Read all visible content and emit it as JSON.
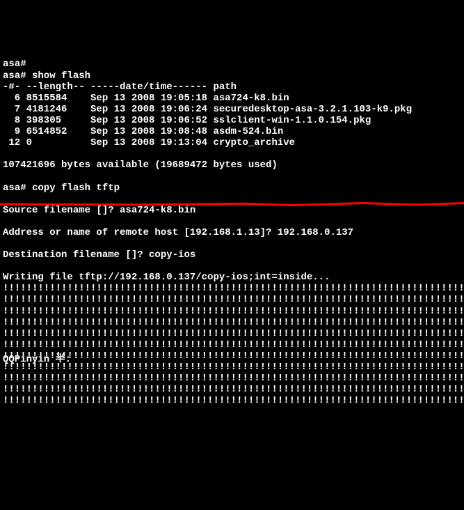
{
  "prompt1": "asa#",
  "prompt2": "asa# show flash",
  "header": "-#- --length-- -----date/time------ path",
  "files": [
    "  6 8515584    Sep 13 2008 19:05:18 asa724-k8.bin",
    "  7 4181246    Sep 13 2008 19:06:24 securedesktop-asa-3.2.1.103-k9.pkg",
    "  8 398305     Sep 13 2008 19:06:52 sslclient-win-1.1.0.154.pkg",
    "  9 6514852    Sep 13 2008 19:08:48 asdm-524.bin",
    " 12 0          Sep 13 2008 19:13:04 crypto_archive"
  ],
  "bytes": "107421696 bytes available (19689472 bytes used)",
  "copy_cmd": "asa# copy flash tftp",
  "src_prompt": "Source filename []? asa724-k8.bin",
  "host_prompt": "Address or name of remote host [192.168.1.13]? 192.168.0.137",
  "dest_prompt": "Destination filename []? copy-ios",
  "writing": "Writing file tftp://192.168.0.137/copy-ios;int=inside...",
  "progress_rows": [
    "!!!!!!!!!!!!!!!!!!!!!!!!!!!!!!!!!!!!!!!!!!!!!!!!!!!!!!!!!!!!!!!!!!!!!!!!!!!!!!!!",
    "!!!!!!!!!!!!!!!!!!!!!!!!!!!!!!!!!!!!!!!!!!!!!!!!!!!!!!!!!!!!!!!!!!!!!!!!!!!!!!!!",
    "!!!!!!!!!!!!!!!!!!!!!!!!!!!!!!!!!!!!!!!!!!!!!!!!!!!!!!!!!!!!!!!!!!!!!!!!!!!!!!!!",
    "!!!!!!!!!!!!!!!!!!!!!!!!!!!!!!!!!!!!!!!!!!!!!!!!!!!!!!!!!!!!!!!!!!!!!!!!!!!!!!!!",
    "!!!!!!!!!!!!!!!!!!!!!!!!!!!!!!!!!!!!!!!!!!!!!!!!!!!!!!!!!!!!!!!!!!!!!!!!!!!!!!!!",
    "!!!!!!!!!!!!!!!!!!!!!!!!!!!!!!!!!!!!!!!!!!!!!!!!!!!!!!!!!!!!!!!!!!!!!!!!!!!!!!!!",
    "!!!!!!!!!!!!!!!!!!!!!!!!!!!!!!!!!!!!!!!!!!!!!!!!!!!!!!!!!!!!!!!!!!!!!!!!!!!!!!!!",
    "!!!!!!!!!!!!!!!!!!!!!!!!!!!!!!!!!!!!!!!!!!!!!!!!!!!!!!!!!!!!!!!!!!!!!!!!!!!!!!!!",
    "!!!!!!!!!!!!!!!!!!!!!!!!!!!!!!!!!!!!!!!!!!!!!!!!!!!!!!!!!!!!!!!!!!!!!!!!!!!!!!!!",
    "!!!!!!!!!!!!!!!!!!!!!!!!!!!!!!!!!!!!!!!!!!!!!!!!!!!!!!!!!!!!!!!!!!!!!!!!!!!!!!!!",
    "!!!!!!!!!!!!!!!!!!!!!!!!!!!!!!!!!!!!!!!!!!!!!!!!!!!!!!!!!!!!!!!!!!!!!!!!!!!!!!!!"
  ],
  "ime": "QQPinyin 半:"
}
